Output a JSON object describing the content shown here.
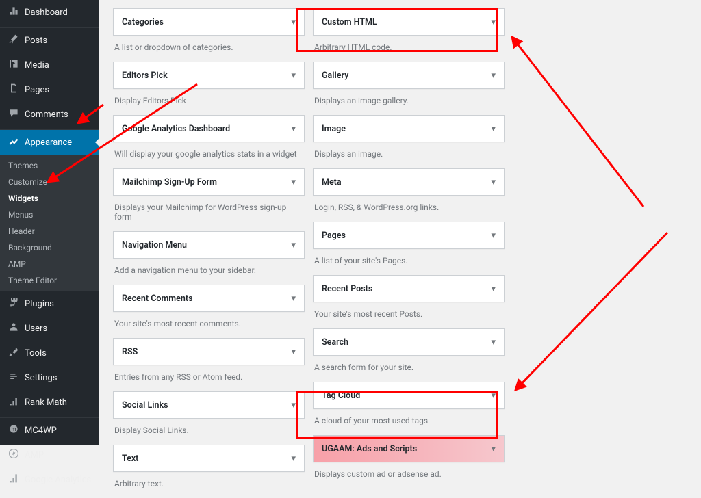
{
  "sidebar": {
    "main": [
      {
        "label": "Dashboard",
        "icon": "dashboard"
      },
      {
        "label": "Posts",
        "icon": "pin"
      },
      {
        "label": "Media",
        "icon": "media"
      },
      {
        "label": "Pages",
        "icon": "pages"
      },
      {
        "label": "Comments",
        "icon": "comments"
      },
      {
        "label": "Appearance",
        "icon": "appearance",
        "current": true
      },
      {
        "label": "Plugins",
        "icon": "plugins"
      },
      {
        "label": "Users",
        "icon": "users"
      },
      {
        "label": "Tools",
        "icon": "tools"
      },
      {
        "label": "Settings",
        "icon": "settings"
      },
      {
        "label": "Rank Math",
        "icon": "rankmath"
      },
      {
        "label": "MC4WP",
        "icon": "mc4wp"
      },
      {
        "label": "AMP",
        "icon": "amp"
      },
      {
        "label": "Google Analytics",
        "icon": "ga"
      }
    ],
    "appearance_submenu": [
      "Themes",
      "Customize",
      "Widgets",
      "Menus",
      "Header",
      "Background",
      "AMP",
      "Theme Editor"
    ],
    "submenu_current_index": 2
  },
  "widgets": {
    "left": [
      {
        "title": "Categories",
        "desc": "A list or dropdown of categories."
      },
      {
        "title": "Editors Pick",
        "desc": "Display Editors Pick"
      },
      {
        "title": "Google Analytics Dashboard",
        "desc": "Will display your google analytics stats in a widget"
      },
      {
        "title": "Mailchimp Sign-Up Form",
        "desc": "Displays your Mailchimp for WordPress sign-up form"
      },
      {
        "title": "Navigation Menu",
        "desc": "Add a navigation menu to your sidebar."
      },
      {
        "title": "Recent Comments",
        "desc": "Your site's most recent comments."
      },
      {
        "title": "RSS",
        "desc": "Entries from any RSS or Atom feed."
      },
      {
        "title": "Social Links",
        "desc": "Display Social Links."
      },
      {
        "title": "Text",
        "desc": "Arbitrary text."
      }
    ],
    "right": [
      {
        "title": "Custom HTML",
        "desc": "Arbitrary HTML code."
      },
      {
        "title": "Gallery",
        "desc": "Displays an image gallery."
      },
      {
        "title": "Image",
        "desc": "Displays an image."
      },
      {
        "title": "Meta",
        "desc": "Login, RSS, & WordPress.org links."
      },
      {
        "title": "Pages",
        "desc": "A list of your site's Pages."
      },
      {
        "title": "Recent Posts",
        "desc": "Your site's most recent Posts."
      },
      {
        "title": "Search",
        "desc": "A search form for your site."
      },
      {
        "title": "Tag Cloud",
        "desc": "A cloud of your most used tags."
      },
      {
        "title": "UGAAM: Ads and Scripts",
        "desc": "Displays custom ad or adsense ad.",
        "highlight": true
      }
    ]
  }
}
